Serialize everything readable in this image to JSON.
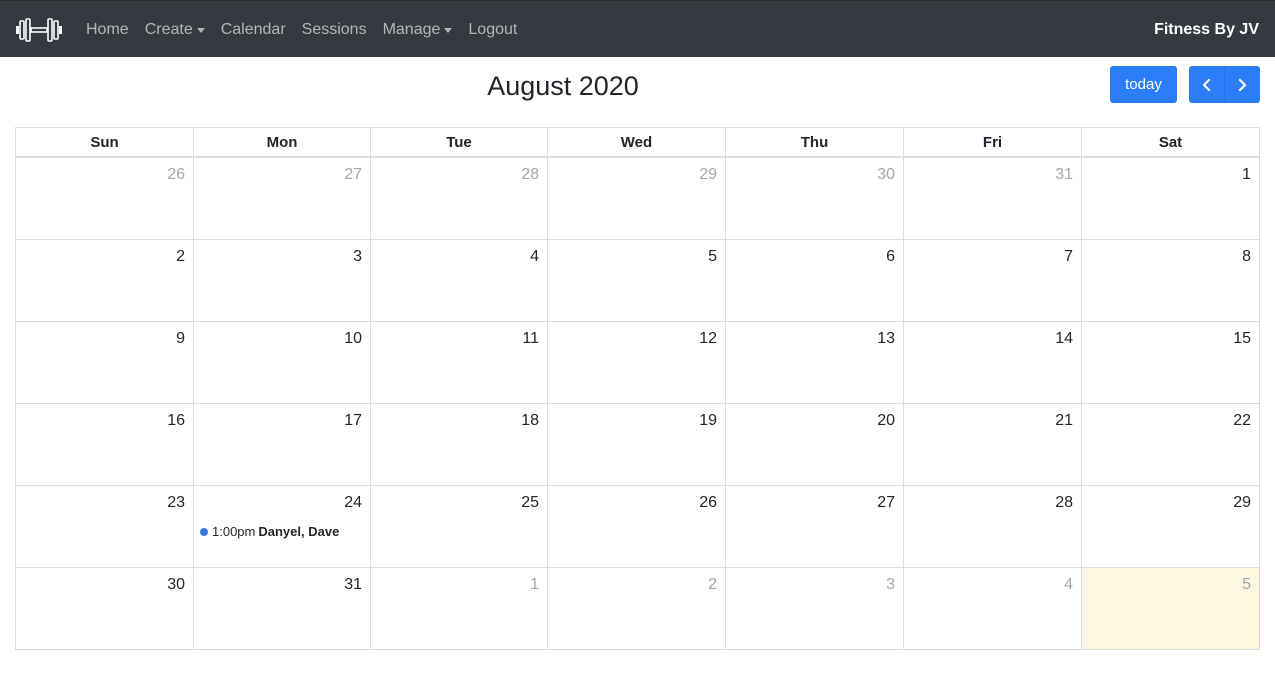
{
  "nav": {
    "links": [
      "Home",
      "Create",
      "Calendar",
      "Sessions",
      "Manage",
      "Logout"
    ],
    "dropdowns": [
      false,
      true,
      false,
      false,
      true,
      false
    ],
    "brand": "Fitness By JV"
  },
  "calendar": {
    "title": "August 2020",
    "today_label": "today",
    "weekdays": [
      "Sun",
      "Mon",
      "Tue",
      "Wed",
      "Thu",
      "Fri",
      "Sat"
    ],
    "weeks": [
      [
        {
          "d": "26",
          "o": true
        },
        {
          "d": "27",
          "o": true
        },
        {
          "d": "28",
          "o": true
        },
        {
          "d": "29",
          "o": true
        },
        {
          "d": "30",
          "o": true
        },
        {
          "d": "31",
          "o": true
        },
        {
          "d": "1",
          "o": false
        }
      ],
      [
        {
          "d": "2",
          "o": false
        },
        {
          "d": "3",
          "o": false
        },
        {
          "d": "4",
          "o": false
        },
        {
          "d": "5",
          "o": false
        },
        {
          "d": "6",
          "o": false
        },
        {
          "d": "7",
          "o": false
        },
        {
          "d": "8",
          "o": false
        }
      ],
      [
        {
          "d": "9",
          "o": false
        },
        {
          "d": "10",
          "o": false
        },
        {
          "d": "11",
          "o": false
        },
        {
          "d": "12",
          "o": false
        },
        {
          "d": "13",
          "o": false
        },
        {
          "d": "14",
          "o": false
        },
        {
          "d": "15",
          "o": false
        }
      ],
      [
        {
          "d": "16",
          "o": false
        },
        {
          "d": "17",
          "o": false
        },
        {
          "d": "18",
          "o": false
        },
        {
          "d": "19",
          "o": false
        },
        {
          "d": "20",
          "o": false
        },
        {
          "d": "21",
          "o": false
        },
        {
          "d": "22",
          "o": false
        }
      ],
      [
        {
          "d": "23",
          "o": false
        },
        {
          "d": "24",
          "o": false,
          "event": {
            "time": "1:00pm",
            "name": "Danyel, Dave"
          }
        },
        {
          "d": "25",
          "o": false
        },
        {
          "d": "26",
          "o": false
        },
        {
          "d": "27",
          "o": false
        },
        {
          "d": "28",
          "o": false
        },
        {
          "d": "29",
          "o": false
        }
      ],
      [
        {
          "d": "30",
          "o": false
        },
        {
          "d": "31",
          "o": false
        },
        {
          "d": "1",
          "o": true
        },
        {
          "d": "2",
          "o": true
        },
        {
          "d": "3",
          "o": true
        },
        {
          "d": "4",
          "o": true
        },
        {
          "d": "5",
          "o": true,
          "today": true
        }
      ]
    ]
  },
  "colors": {
    "navbar": "#343a40",
    "accent": "#2c7ef8",
    "event_dot": "#3a78e6",
    "today_bg": "#fdf7e1"
  }
}
